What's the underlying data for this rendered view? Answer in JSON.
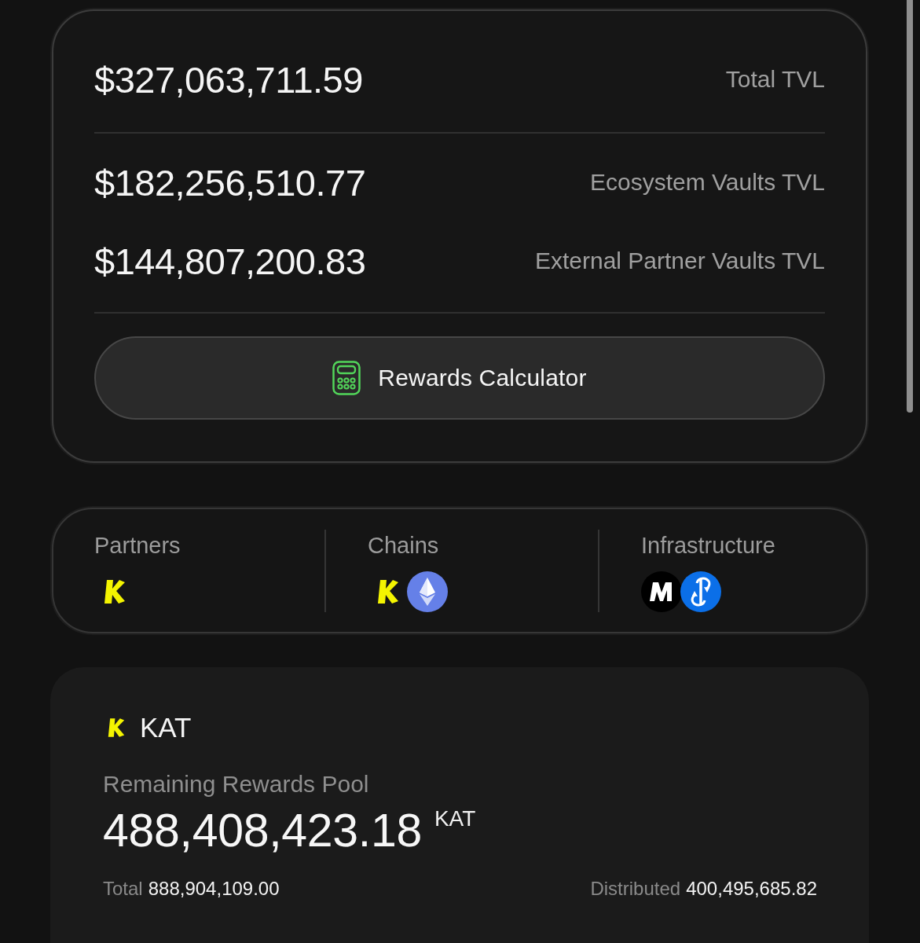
{
  "tvl_card": {
    "total": {
      "value": "$327,063,711.59",
      "label": "Total TVL"
    },
    "breakdown": [
      {
        "value": "$182,256,510.77",
        "label": "Ecosystem Vaults TVL"
      },
      {
        "value": "$144,807,200.83",
        "label": "External Partner Vaults TVL"
      }
    ],
    "calculator_button": {
      "label": "Rewards Calculator"
    }
  },
  "ecosystem_card": {
    "columns": [
      {
        "title": "Partners"
      },
      {
        "title": "Chains"
      },
      {
        "title": "Infrastructure"
      }
    ]
  },
  "rewards_card": {
    "token": "KAT",
    "pool_label": "Remaining Rewards Pool",
    "remaining": "488,408,423.18",
    "unit": "KAT",
    "total": {
      "label": "Total",
      "value": "888,904,109.00"
    },
    "distributed": {
      "label": "Distributed",
      "value": "400,495,685.82"
    }
  }
}
